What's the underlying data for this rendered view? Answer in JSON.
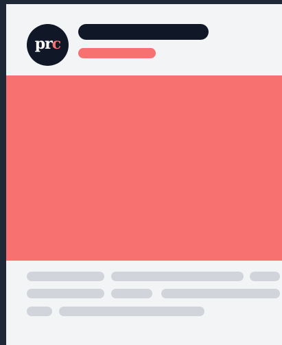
{
  "card": {
    "logo": {
      "text_main": "pr",
      "text_accent": "c"
    }
  },
  "colors": {
    "frame_bg": "#1f2836",
    "card_bg": "#f3f4f6",
    "dark": "#101828",
    "accent": "#f87171",
    "skeleton": "#d1d5db"
  },
  "icons": {
    "avatar": "brand-logo-icon"
  }
}
